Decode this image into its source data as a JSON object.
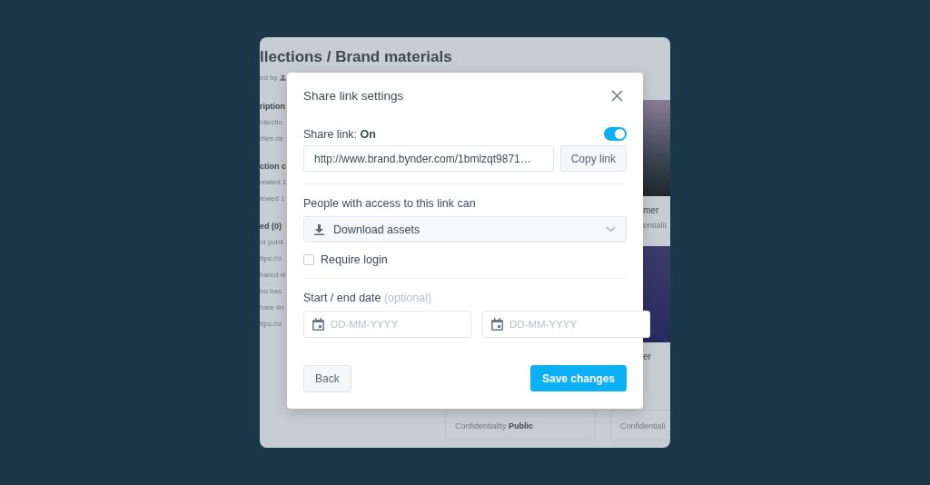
{
  "background": {
    "title": "llections / Brand materials",
    "byline": "ed by",
    "sidebar": [
      {
        "kind": "heading",
        "text": "ription"
      },
      {
        "kind": "text",
        "text": "ollectio"
      },
      {
        "kind": "text",
        "text": "rties de"
      },
      {
        "kind": "heading",
        "text": "ction c"
      },
      {
        "kind": "text",
        "text": "reated 1"
      },
      {
        "kind": "text",
        "text": "iewed 1"
      },
      {
        "kind": "heading",
        "text": "ed (0)"
      },
      {
        "kind": "text",
        "text": "ot publi"
      },
      {
        "kind": "text",
        "text": "ttps://d"
      },
      {
        "kind": "text",
        "text": "hared w"
      },
      {
        "kind": "text",
        "text": "ho has"
      },
      {
        "kind": "text",
        "text": "hare lin"
      },
      {
        "kind": "text",
        "text": "ttps://d"
      }
    ],
    "cards": [
      {
        "title": "mer",
        "meta": "entialit"
      },
      {
        "title": "er"
      }
    ],
    "bottom_cards": [
      {
        "label": "Confidentiality",
        "value": "Public"
      },
      {
        "label": "Confidentiali"
      }
    ]
  },
  "dialog": {
    "title": "Share link settings",
    "share_link": {
      "label": "Share link:",
      "state_text": "On",
      "on": true
    },
    "url": "http://www.brand.bynder.com/1bmlzqt9871…",
    "copy_button": "Copy link",
    "access_label": "People with access to this link can",
    "access_value": "Download assets",
    "require_login": {
      "label": "Require login",
      "checked": false
    },
    "date_label": "Start / end date",
    "date_hint": "(optional)",
    "date_fields": [
      {
        "placeholder": "DD-MM-YYYY"
      },
      {
        "placeholder": "DD-MM-YYYY"
      }
    ],
    "buttons": {
      "back": "Back",
      "save": "Save changes"
    }
  }
}
